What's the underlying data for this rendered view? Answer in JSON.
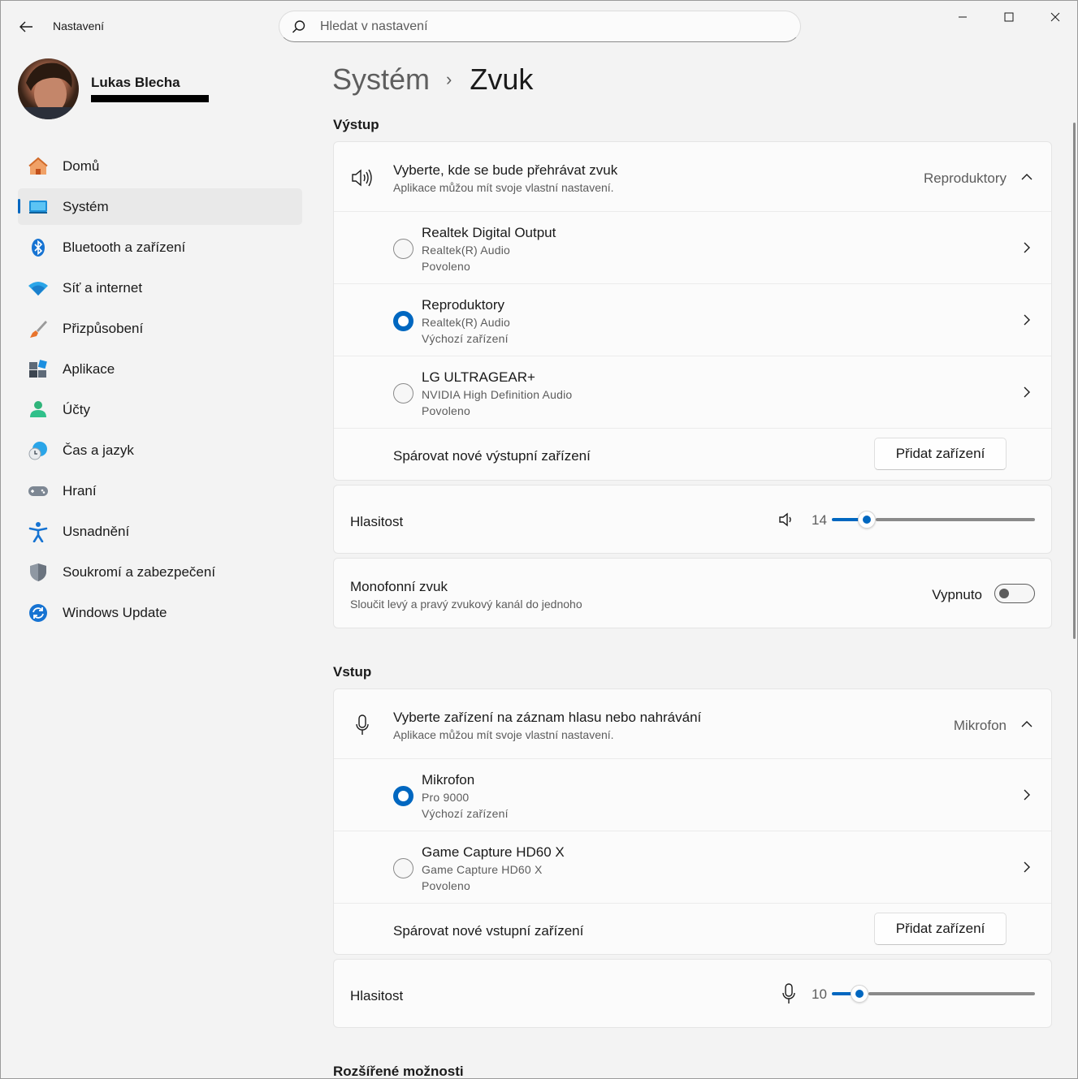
{
  "app": {
    "title": "Nastavení"
  },
  "search": {
    "placeholder": "Hledat v nastavení"
  },
  "profile": {
    "name": "Lukas Blecha"
  },
  "sidebar": {
    "items": [
      {
        "label": "Domů",
        "icon": "home-icon"
      },
      {
        "label": "Systém",
        "icon": "system-icon",
        "active": true
      },
      {
        "label": "Bluetooth a zařízení",
        "icon": "bluetooth-icon"
      },
      {
        "label": "Síť a internet",
        "icon": "wifi-icon"
      },
      {
        "label": "Přizpůsobení",
        "icon": "brush-icon"
      },
      {
        "label": "Aplikace",
        "icon": "apps-icon"
      },
      {
        "label": "Účty",
        "icon": "account-icon"
      },
      {
        "label": "Čas a jazyk",
        "icon": "time-language-icon"
      },
      {
        "label": "Hraní",
        "icon": "gamepad-icon"
      },
      {
        "label": "Usnadnění",
        "icon": "accessibility-icon"
      },
      {
        "label": "Soukromí a zabezpečení",
        "icon": "shield-icon"
      },
      {
        "label": "Windows Update",
        "icon": "update-icon"
      }
    ]
  },
  "breadcrumb": {
    "parent": "Systém",
    "separator": "›",
    "current": "Zvuk"
  },
  "output": {
    "section_title": "Výstup",
    "header": {
      "title": "Vyberte, kde se bude přehrávat zvuk",
      "subtitle": "Aplikace můžou mít svoje vlastní nastavení.",
      "selected": "Reproduktory"
    },
    "devices": [
      {
        "name": "Realtek Digital Output",
        "driver": "Realtek(R) Audio",
        "status": "Povoleno",
        "selected": false
      },
      {
        "name": "Reproduktory",
        "driver": "Realtek(R) Audio",
        "status": "Výchozí zařízení",
        "selected": true
      },
      {
        "name": "LG ULTRAGEAR+",
        "driver": "NVIDIA High Definition Audio",
        "status": "Povoleno",
        "selected": false
      }
    ],
    "pair": {
      "label": "Spárovat nové výstupní zařízení",
      "button": "Přidat zařízení"
    },
    "volume": {
      "label": "Hlasitost",
      "value": "14",
      "fraction": 0.14
    },
    "mono": {
      "title": "Monofonní zvuk",
      "subtitle": "Sloučit levý a pravý zvukový kanál do jednoho",
      "state": "Vypnuto"
    }
  },
  "input": {
    "section_title": "Vstup",
    "header": {
      "title": "Vyberte zařízení na záznam hlasu nebo nahrávání",
      "subtitle": "Aplikace můžou mít svoje vlastní nastavení.",
      "selected": "Mikrofon"
    },
    "devices": [
      {
        "name": "Mikrofon",
        "driver": "Pro 9000",
        "status": "Výchozí zařízení",
        "selected": true
      },
      {
        "name": "Game Capture HD60 X",
        "driver": "Game Capture HD60 X",
        "status": "Povoleno",
        "selected": false
      }
    ],
    "pair": {
      "label": "Spárovat nové vstupní zařízení",
      "button": "Přidat zařízení"
    },
    "volume": {
      "label": "Hlasitost",
      "value": "10",
      "fraction": 0.1
    }
  },
  "advanced": {
    "section_title": "Rozšířené možnosti"
  },
  "colors": {
    "accent": "#0067c0"
  }
}
